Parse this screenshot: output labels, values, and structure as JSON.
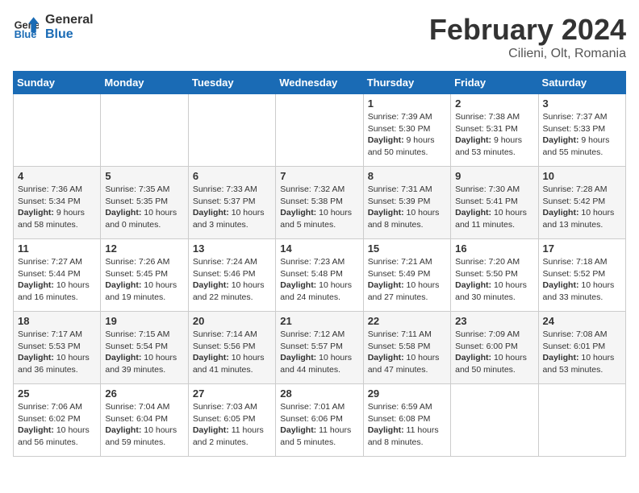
{
  "header": {
    "logo_line1": "General",
    "logo_line2": "Blue",
    "title": "February 2024",
    "subtitle": "Cilieni, Olt, Romania"
  },
  "weekdays": [
    "Sunday",
    "Monday",
    "Tuesday",
    "Wednesday",
    "Thursday",
    "Friday",
    "Saturday"
  ],
  "weeks": [
    [
      {
        "day": "",
        "info": ""
      },
      {
        "day": "",
        "info": ""
      },
      {
        "day": "",
        "info": ""
      },
      {
        "day": "",
        "info": ""
      },
      {
        "day": "1",
        "info": "Sunrise: 7:39 AM\nSunset: 5:30 PM\nDaylight: 9 hours and 50 minutes."
      },
      {
        "day": "2",
        "info": "Sunrise: 7:38 AM\nSunset: 5:31 PM\nDaylight: 9 hours and 53 minutes."
      },
      {
        "day": "3",
        "info": "Sunrise: 7:37 AM\nSunset: 5:33 PM\nDaylight: 9 hours and 55 minutes."
      }
    ],
    [
      {
        "day": "4",
        "info": "Sunrise: 7:36 AM\nSunset: 5:34 PM\nDaylight: 9 hours and 58 minutes."
      },
      {
        "day": "5",
        "info": "Sunrise: 7:35 AM\nSunset: 5:35 PM\nDaylight: 10 hours and 0 minutes."
      },
      {
        "day": "6",
        "info": "Sunrise: 7:33 AM\nSunset: 5:37 PM\nDaylight: 10 hours and 3 minutes."
      },
      {
        "day": "7",
        "info": "Sunrise: 7:32 AM\nSunset: 5:38 PM\nDaylight: 10 hours and 5 minutes."
      },
      {
        "day": "8",
        "info": "Sunrise: 7:31 AM\nSunset: 5:39 PM\nDaylight: 10 hours and 8 minutes."
      },
      {
        "day": "9",
        "info": "Sunrise: 7:30 AM\nSunset: 5:41 PM\nDaylight: 10 hours and 11 minutes."
      },
      {
        "day": "10",
        "info": "Sunrise: 7:28 AM\nSunset: 5:42 PM\nDaylight: 10 hours and 13 minutes."
      }
    ],
    [
      {
        "day": "11",
        "info": "Sunrise: 7:27 AM\nSunset: 5:44 PM\nDaylight: 10 hours and 16 minutes."
      },
      {
        "day": "12",
        "info": "Sunrise: 7:26 AM\nSunset: 5:45 PM\nDaylight: 10 hours and 19 minutes."
      },
      {
        "day": "13",
        "info": "Sunrise: 7:24 AM\nSunset: 5:46 PM\nDaylight: 10 hours and 22 minutes."
      },
      {
        "day": "14",
        "info": "Sunrise: 7:23 AM\nSunset: 5:48 PM\nDaylight: 10 hours and 24 minutes."
      },
      {
        "day": "15",
        "info": "Sunrise: 7:21 AM\nSunset: 5:49 PM\nDaylight: 10 hours and 27 minutes."
      },
      {
        "day": "16",
        "info": "Sunrise: 7:20 AM\nSunset: 5:50 PM\nDaylight: 10 hours and 30 minutes."
      },
      {
        "day": "17",
        "info": "Sunrise: 7:18 AM\nSunset: 5:52 PM\nDaylight: 10 hours and 33 minutes."
      }
    ],
    [
      {
        "day": "18",
        "info": "Sunrise: 7:17 AM\nSunset: 5:53 PM\nDaylight: 10 hours and 36 minutes."
      },
      {
        "day": "19",
        "info": "Sunrise: 7:15 AM\nSunset: 5:54 PM\nDaylight: 10 hours and 39 minutes."
      },
      {
        "day": "20",
        "info": "Sunrise: 7:14 AM\nSunset: 5:56 PM\nDaylight: 10 hours and 41 minutes."
      },
      {
        "day": "21",
        "info": "Sunrise: 7:12 AM\nSunset: 5:57 PM\nDaylight: 10 hours and 44 minutes."
      },
      {
        "day": "22",
        "info": "Sunrise: 7:11 AM\nSunset: 5:58 PM\nDaylight: 10 hours and 47 minutes."
      },
      {
        "day": "23",
        "info": "Sunrise: 7:09 AM\nSunset: 6:00 PM\nDaylight: 10 hours and 50 minutes."
      },
      {
        "day": "24",
        "info": "Sunrise: 7:08 AM\nSunset: 6:01 PM\nDaylight: 10 hours and 53 minutes."
      }
    ],
    [
      {
        "day": "25",
        "info": "Sunrise: 7:06 AM\nSunset: 6:02 PM\nDaylight: 10 hours and 56 minutes."
      },
      {
        "day": "26",
        "info": "Sunrise: 7:04 AM\nSunset: 6:04 PM\nDaylight: 10 hours and 59 minutes."
      },
      {
        "day": "27",
        "info": "Sunrise: 7:03 AM\nSunset: 6:05 PM\nDaylight: 11 hours and 2 minutes."
      },
      {
        "day": "28",
        "info": "Sunrise: 7:01 AM\nSunset: 6:06 PM\nDaylight: 11 hours and 5 minutes."
      },
      {
        "day": "29",
        "info": "Sunrise: 6:59 AM\nSunset: 6:08 PM\nDaylight: 11 hours and 8 minutes."
      },
      {
        "day": "",
        "info": ""
      },
      {
        "day": "",
        "info": ""
      }
    ]
  ]
}
